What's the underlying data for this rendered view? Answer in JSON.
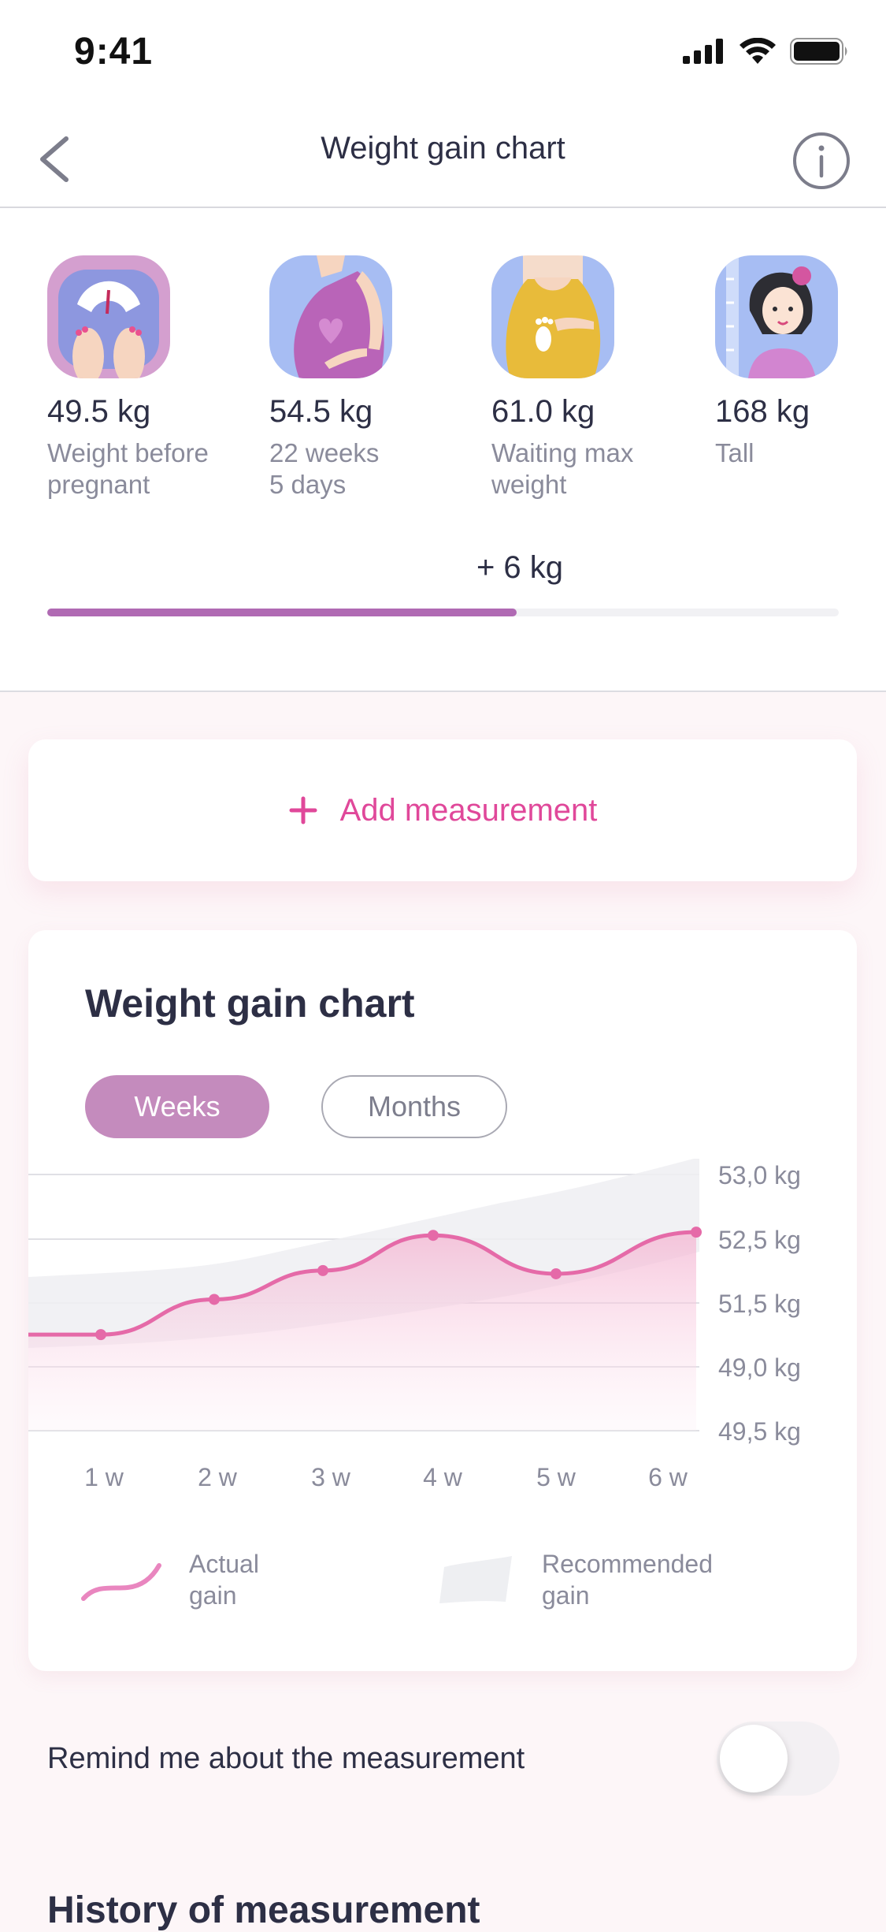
{
  "status_bar": {
    "time": "9:41"
  },
  "nav": {
    "title": "Weight gain chart",
    "back_icon": "chevron-left-icon",
    "info_icon": "info-icon"
  },
  "stats": [
    {
      "value": "49.5 kg",
      "label_line1": "Weight before",
      "label_line2": "pregnant"
    },
    {
      "value": "54.5 kg",
      "label_line1": "22 weeks",
      "label_line2": "5 days"
    },
    {
      "value": "61.0 kg",
      "label_line1": "Waiting max",
      "label_line2": "weight"
    },
    {
      "value": "168 kg",
      "label_line1": "Tall",
      "label_line2": ""
    }
  ],
  "gain": {
    "text": "+ 6 kg",
    "progress": 0.593
  },
  "add_measurement": {
    "icon": "plus-icon",
    "label": "Add measurement"
  },
  "chart_section": {
    "title": "Weight gain chart",
    "tabs": [
      {
        "label": "Weeks",
        "active": true
      },
      {
        "label": "Months",
        "active": false
      }
    ]
  },
  "chart_data": {
    "type": "line",
    "categories": [
      "1 w",
      "2 w",
      "3 w",
      "4 w",
      "5 w",
      "6 w"
    ],
    "y_tick_labels": [
      "53,0 kg",
      "52,5 kg",
      "51,5 kg",
      "49,0 kg",
      "49,5 kg"
    ],
    "series": [
      {
        "name": "Actual gain",
        "type": "line",
        "color": "#e56aa8",
        "levels": [
          1.5,
          2.05,
          2.5,
          3.05,
          2.45,
          3.1
        ]
      },
      {
        "name": "Recommended gain",
        "type": "band",
        "color": "#eeeff2"
      }
    ],
    "legend": [
      {
        "label_line1": "Actual",
        "label_line2": "gain"
      },
      {
        "label_line1": "Recommended",
        "label_line2": "gain"
      }
    ],
    "grid": true,
    "legend_position": "bottom"
  },
  "reminder": {
    "label": "Remind me about the measurement",
    "enabled": false
  },
  "history": {
    "title": "History of measurement"
  },
  "colors": {
    "accent": "#e0489a",
    "purple": "#b06ab3",
    "chip": "#c48bbd"
  }
}
